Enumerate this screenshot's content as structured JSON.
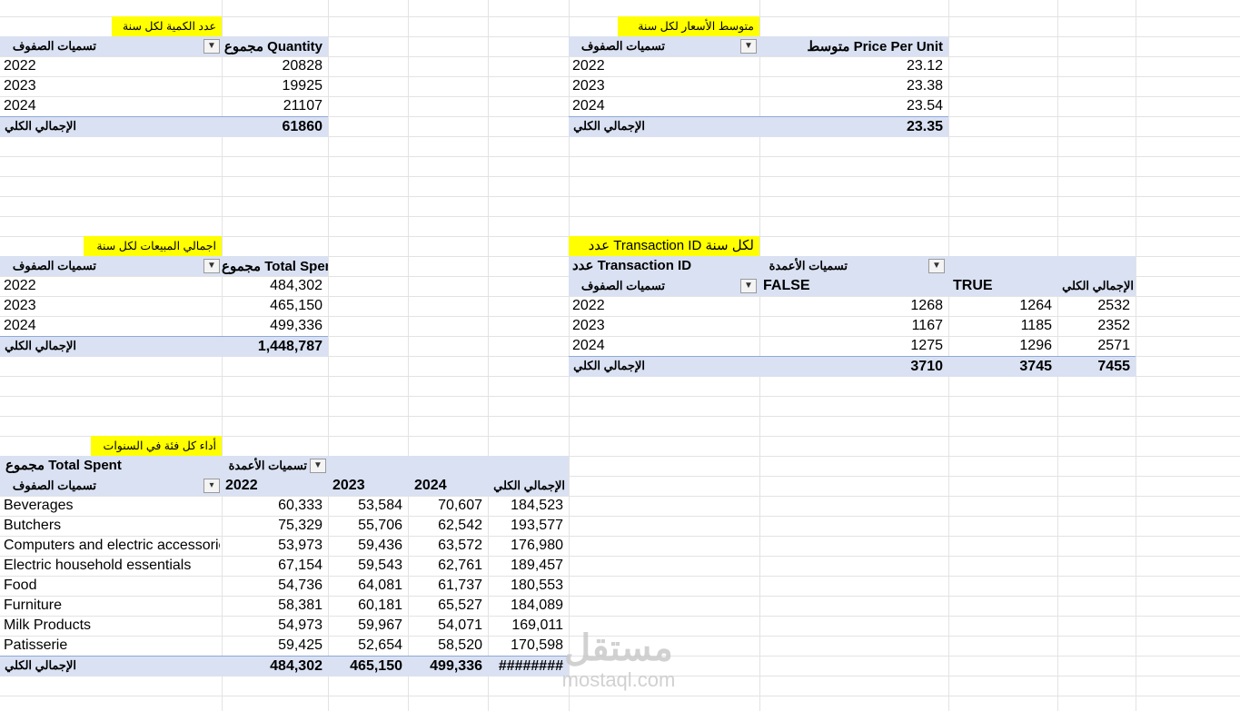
{
  "pivot_quantity": {
    "title": "عدد الكمية لكل سنة",
    "row_labels_header": "تسميات الصفوف",
    "value_header": "مجموع Quantity",
    "rows": [
      {
        "label": "2022",
        "value": "20828"
      },
      {
        "label": "2023",
        "value": "19925"
      },
      {
        "label": "2024",
        "value": "21107"
      }
    ],
    "total_label": "الإجمالي الكلي",
    "total_value": "61860"
  },
  "pivot_price": {
    "title": "متوسط الأسعار لكل سنة",
    "row_labels_header": "تسميات الصفوف",
    "value_header": "متوسط Price Per Unit",
    "rows": [
      {
        "label": "2022",
        "value": "23.12"
      },
      {
        "label": "2023",
        "value": "23.38"
      },
      {
        "label": "2024",
        "value": "23.54"
      }
    ],
    "total_label": "الإجمالي الكلي",
    "total_value": "23.35"
  },
  "pivot_sales": {
    "title": "اجمالي المبيعات لكل سنة",
    "row_labels_header": "تسميات الصفوف",
    "value_header": "مجموع Total Spent",
    "rows": [
      {
        "label": "2022",
        "value": "484,302"
      },
      {
        "label": "2023",
        "value": "465,150"
      },
      {
        "label": "2024",
        "value": "499,336"
      }
    ],
    "total_label": "الإجمالي الكلي",
    "total_value": "1,448,787"
  },
  "pivot_txn": {
    "title": "عدد Transaction ID لكل سنة",
    "value_header": "عدد Transaction ID",
    "col_labels_header": "تسميات الأعمدة",
    "row_labels_header": "تسميات الصفوف",
    "col_false": "FALSE",
    "col_true": "TRUE",
    "col_total": "الإجمالي الكلي",
    "rows": [
      {
        "label": "2022",
        "false": "1268",
        "true": "1264",
        "total": "2532"
      },
      {
        "label": "2023",
        "false": "1167",
        "true": "1185",
        "total": "2352"
      },
      {
        "label": "2024",
        "false": "1275",
        "true": "1296",
        "total": "2571"
      }
    ],
    "total_label": "الإجمالي الكلي",
    "total_false": "3710",
    "total_true": "3745",
    "total_total": "7455"
  },
  "pivot_category": {
    "title": "أداء كل فئة في السنوات",
    "value_header": "مجموع Total Spent",
    "col_labels_header": "تسميات الأعمدة",
    "row_labels_header": "تسميات الصفوف",
    "col_2022": "2022",
    "col_2023": "2023",
    "col_2024": "2024",
    "col_total": "الإجمالي الكلي",
    "rows": [
      {
        "label": "Beverages",
        "y2022": "60,333",
        "y2023": "53,584",
        "y2024": "70,607",
        "total": "184,523"
      },
      {
        "label": "Butchers",
        "y2022": "75,329",
        "y2023": "55,706",
        "y2024": "62,542",
        "total": "193,577"
      },
      {
        "label": "Computers and electric accessories",
        "y2022": "53,973",
        "y2023": "59,436",
        "y2024": "63,572",
        "total": "176,980"
      },
      {
        "label": "Electric household essentials",
        "y2022": "67,154",
        "y2023": "59,543",
        "y2024": "62,761",
        "total": "189,457"
      },
      {
        "label": "Food",
        "y2022": "54,736",
        "y2023": "64,081",
        "y2024": "61,737",
        "total": "180,553"
      },
      {
        "label": "Furniture",
        "y2022": "58,381",
        "y2023": "60,181",
        "y2024": "65,527",
        "total": "184,089"
      },
      {
        "label": "Milk Products",
        "y2022": "54,973",
        "y2023": "59,967",
        "y2024": "54,071",
        "total": "169,011"
      },
      {
        "label": "Patisserie",
        "y2022": "59,425",
        "y2023": "52,654",
        "y2024": "58,520",
        "total": "170,598"
      }
    ],
    "total_label": "الإجمالي الكلي",
    "total_2022": "484,302",
    "total_2023": "465,150",
    "total_2024": "499,336",
    "total_total": "########"
  },
  "watermark": {
    "arabic": "مستقل",
    "latin": "mostaql.com"
  },
  "colors": {
    "title_fill": "#ffff00",
    "header_band": "#d9e1f2",
    "gridline": "#e3e3e3"
  }
}
